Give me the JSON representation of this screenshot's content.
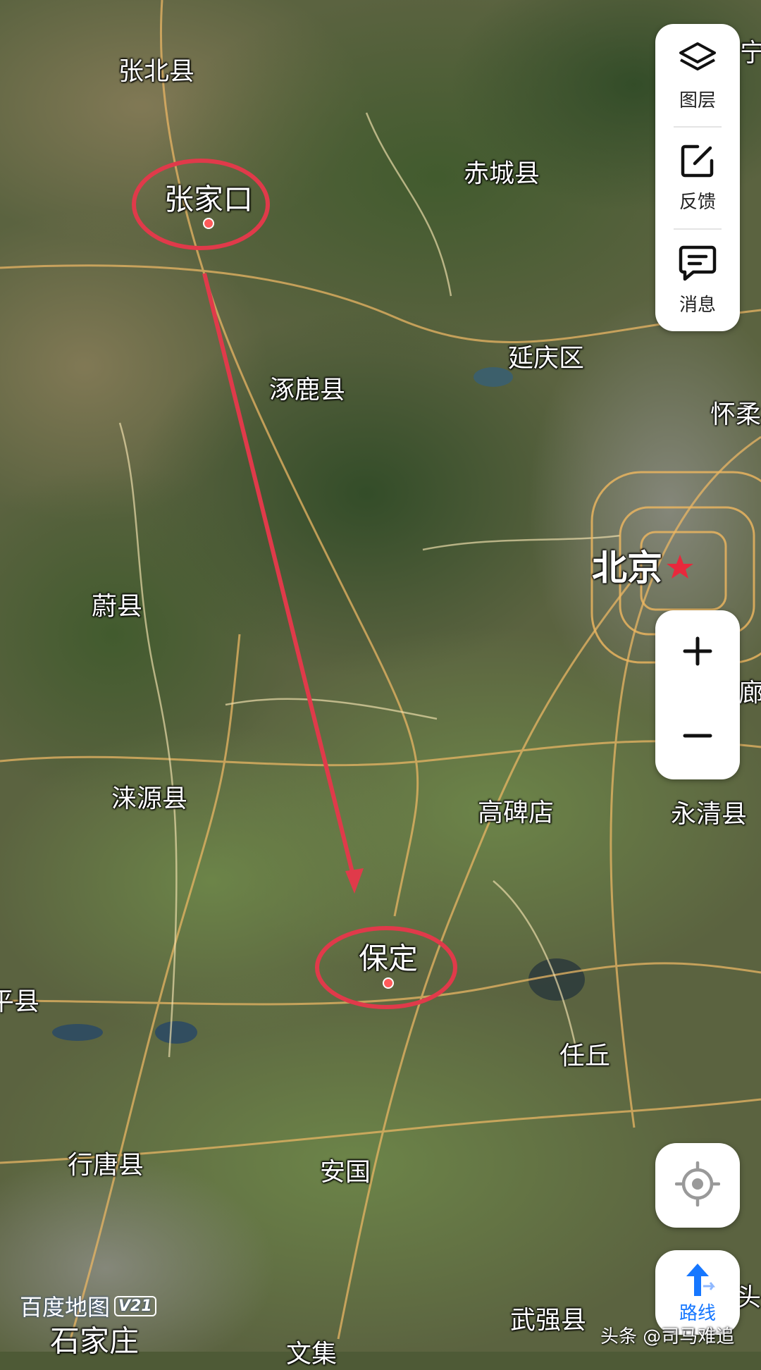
{
  "map": {
    "labels": {
      "zhangbei": "张北县",
      "chicheng": "赤城县",
      "zhangjiakou": "张家口",
      "yanqing": "延庆区",
      "zhuolu": "涿鹿县",
      "huairou_partial": "怀柔",
      "beijing": "北京",
      "yuxian": "蔚县",
      "laiyuan": "涞源县",
      "gaobeidian": "高碑店",
      "yongqing": "永清县",
      "baoding": "保定",
      "renqiu": "任丘",
      "left_edge_county": "平县",
      "xingtang": "行唐县",
      "anguo": "安国",
      "wuqiang": "武强县",
      "shijiazhuang": "石家庄",
      "wenan_partial": "文集",
      "top_right_partial": "宁",
      "right_mid_partial": "廊",
      "right_bottom_partial": "头"
    }
  },
  "toolbar": {
    "layers_label": "图层",
    "feedback_label": "反馈",
    "messages_label": "消息"
  },
  "route": {
    "label": "路线"
  },
  "branding": {
    "logo_text": "百度地图",
    "logo_version": "V21"
  },
  "watermark": "头条 @司马难追",
  "colors": {
    "annotation_red": "#e03a4a",
    "accent_blue": "#1677ff",
    "capital_star": "#e8283c"
  },
  "icons": {
    "layers": "layers-icon",
    "feedback": "edit-icon",
    "messages": "message-icon",
    "zoom_in": "plus-icon",
    "zoom_out": "minus-icon",
    "locate": "locate-icon",
    "route": "route-arrow-icon"
  }
}
